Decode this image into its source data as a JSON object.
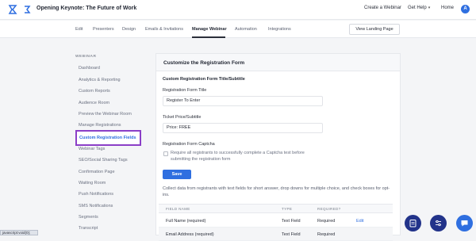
{
  "header": {
    "title": "Opening Keynote: The Future of Work",
    "nav": {
      "create": "Create a Webinar",
      "help": "Get Help",
      "home": "Home"
    },
    "avatar_initial": "A"
  },
  "tabs": [
    "Edit",
    "Presenters",
    "Design",
    "Emails & Invitations",
    "Manage Webinar",
    "Automation",
    "Integrations"
  ],
  "landing_button": "View Landing Page",
  "sidebar": {
    "heading": "WEBINAR",
    "items": [
      "Dashboard",
      "Analytics & Reporting",
      "Custom Reports",
      "Audience Room",
      "Preview the Webinar Room",
      "Manage Registrations",
      "Custom Registration Fields",
      "Webinar Tags",
      "SEO/Social Sharing Tags",
      "Confirmation Page",
      "Waiting Room",
      "Push Notifications",
      "SMS Notifications",
      "Segments",
      "Transcript"
    ]
  },
  "form": {
    "panel_title": "Customize the Registration Form",
    "section_title": "Custom Registration Form Title/Subtitle",
    "title_label": "Registration Form Title",
    "title_value": "Register To Enter",
    "ticket_label": "Ticket Price/Subtitle",
    "ticket_value": "Price: FREE",
    "captcha_label": "Registration Form Captcha",
    "captcha_text": "Require all registrants to successfully complete a Captcha test before submitting the registration form",
    "save": "Save",
    "description": "Collect data from registrants with text fields for short answer, drop downs for multiple choice, and check boxes for opt-ins."
  },
  "table": {
    "headers": [
      "FIELD NAME",
      "TYPE",
      "REQUIRED?"
    ],
    "rows": [
      {
        "name": "Full Name (required)",
        "type": "Text Field",
        "required": "Required",
        "action": "Edit"
      },
      {
        "name": "Email Address (required)",
        "type": "Text Field",
        "required": "Required",
        "action": ""
      }
    ]
  },
  "status_text": "javascript:void(0);",
  "colors": {
    "accent": "#2f6fe0",
    "highlight": "#8b3fc7",
    "fab": "#22338a"
  }
}
